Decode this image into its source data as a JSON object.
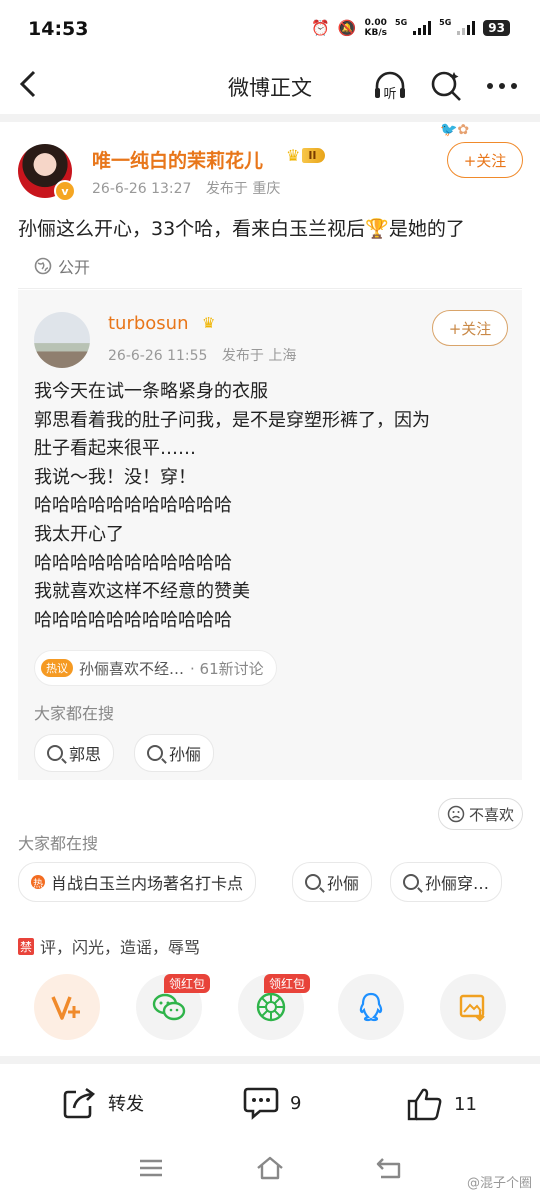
{
  "status_bar": {
    "time": "14:53",
    "net_speed_value": "0.00",
    "net_speed_unit": "KB/s",
    "sim1": "5G",
    "sim2": "5G",
    "battery": "93"
  },
  "nav": {
    "title": "微博正文",
    "listen_label": "听"
  },
  "post": {
    "username": "唯一纯白的茉莉花儿",
    "level_badge": "II",
    "timestamp": "26-6-26 13:27",
    "location": "发布于 重庆",
    "follow_label": "+关注",
    "text": "孙俪这么开心，33个哈，看来白玉兰视后🏆是她的了",
    "visibility": "公开"
  },
  "repost": {
    "username": "turbosun",
    "timestamp": "26-6-26 11:55",
    "location": "发布于 上海",
    "follow_label": "+关注",
    "lines": [
      "我今天在试一条略紧身的衣服",
      "郭思看着我的肚子问我，是不是穿塑形裤了，因为",
      "肚子看起来很平……",
      "我说～我！没！穿！",
      "哈哈哈哈哈哈哈哈哈哈哈",
      "我太开心了",
      "哈哈哈哈哈哈哈哈哈哈哈",
      "我就喜欢这样不经意的赞美",
      "哈哈哈哈哈哈哈哈哈哈哈"
    ],
    "topic": {
      "tag": "热议",
      "text": "孙俪喜欢不经…",
      "count": "· 61新讨论"
    },
    "search_label": "大家都在搜",
    "search_chips": [
      "郭思",
      "孙俪"
    ]
  },
  "dislike_label": "不喜欢",
  "search_label": "大家都在搜",
  "search_chips": [
    {
      "label": "肖战白玉兰内场著名打卡点",
      "hot": true
    },
    {
      "label": "孙俪",
      "hot": false
    },
    {
      "label": "孙俪穿…",
      "hot": false
    }
  ],
  "ban_notice": {
    "badge": "禁",
    "text": "评，闪光，造谣，辱骂"
  },
  "share": {
    "red_packet_label": "领红包",
    "items": [
      "weibo-plus",
      "wechat",
      "moments",
      "qq",
      "save-image"
    ]
  },
  "actions": {
    "repost_label": "转发",
    "comment_count": "9",
    "like_count": "11"
  },
  "watermark": "@混子个圈",
  "colors": {
    "accent": "#e8761a",
    "follow_border": "#f08a2b",
    "red": "#e8433a",
    "wechat_green": "#2fb44a",
    "qq_blue": "#1e90ff",
    "gold": "#f0b400"
  }
}
